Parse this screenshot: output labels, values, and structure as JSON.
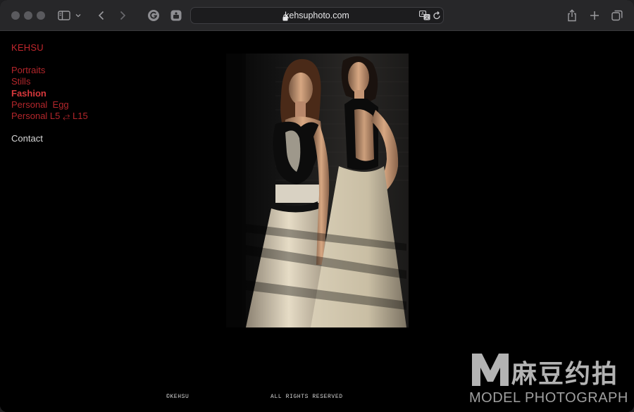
{
  "browser": {
    "url": "kehsuphoto.com",
    "icons": {
      "sidebar": "sidebar-icon",
      "tab_chevron": "chevron-down-icon",
      "back": "chevron-left-icon",
      "forward": "chevron-right-icon",
      "extension_g": "grammarly-icon",
      "extension_photo": "photo-extension-icon",
      "lock": "lock-icon",
      "translate": "translate-icon",
      "reload": "reload-icon",
      "share": "share-icon",
      "new_tab": "plus-icon",
      "tab_overview": "tab-overview-icon"
    }
  },
  "site": {
    "title": "KEHSU",
    "nav": [
      {
        "label": "Portraits",
        "active": false
      },
      {
        "label": "Stills",
        "active": false
      },
      {
        "label": "Fashion",
        "active": true
      },
      {
        "label": "Personal  Egg",
        "active": false
      },
      {
        "label": "Personal L5 ⥄ L15",
        "active": false
      }
    ],
    "contact_label": "Contact",
    "footer_left": "©KEHSU",
    "footer_right": "ALL RIGHTS RESERVED"
  },
  "watermark": {
    "chinese": "麻豆约拍",
    "english": "MODEL PHOTOGRAPH"
  },
  "colors": {
    "accent_red": "#c1272d",
    "background": "#000000",
    "toolbar": "#272729"
  }
}
